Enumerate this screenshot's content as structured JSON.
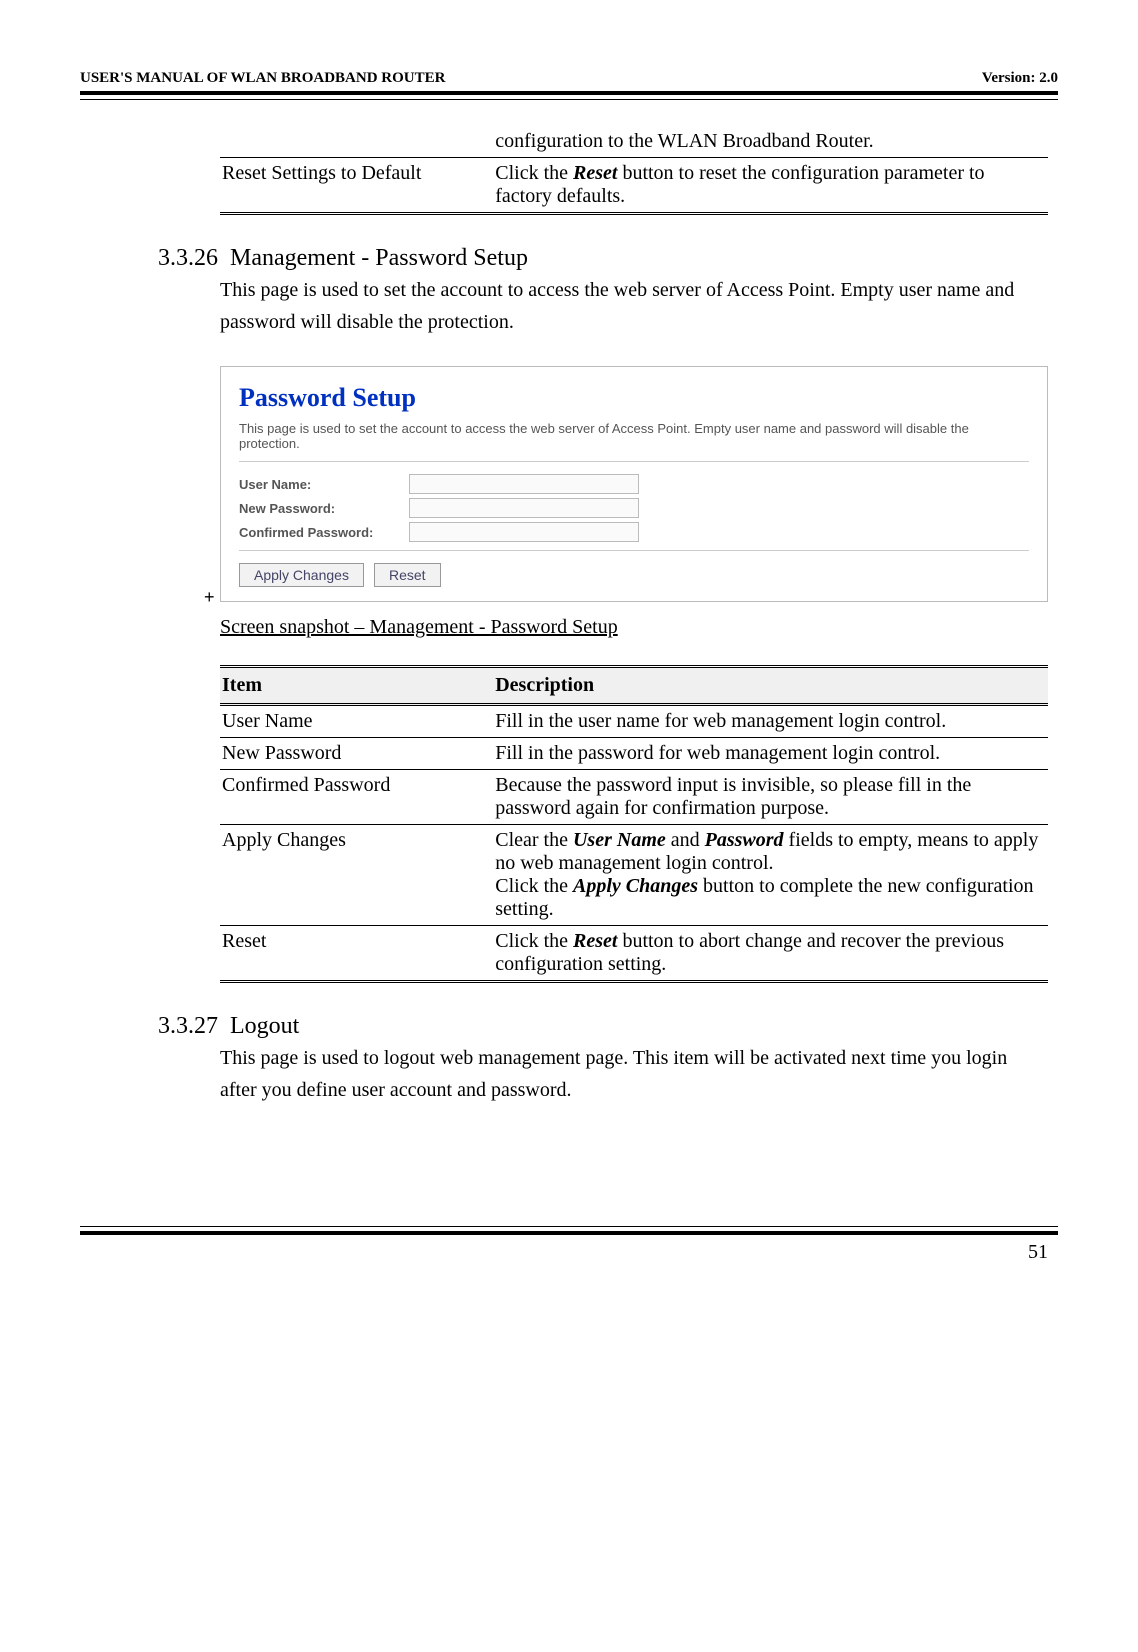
{
  "header": {
    "left": "USER'S MANUAL OF WLAN BROADBAND ROUTER",
    "right": "Version: 2.0"
  },
  "topTable": {
    "row0": {
      "item": "",
      "desc": "configuration to the WLAN Broadband Router."
    },
    "row1": {
      "item": "Reset Settings to Default",
      "desc_pre": "Click the ",
      "desc_bold": "Reset",
      "desc_post": " button to reset the configuration parameter to factory defaults."
    }
  },
  "section26": {
    "num": "3.3.26",
    "title": "Management - Password Setup",
    "body": "This page is used to set the account to access the web server of Access Point. Empty user name and password will disable the protection."
  },
  "passwordSetup": {
    "title": "Password Setup",
    "desc": "This page is used to set the account to access the web server of Access Point. Empty user name and password will disable the protection.",
    "labels": {
      "user": "User Name:",
      "newpw": "New Password:",
      "confpw": "Confirmed Password:"
    },
    "buttons": {
      "apply": "Apply Changes",
      "reset": "Reset"
    }
  },
  "caption26": "Screen snapshot – Management - Password Setup",
  "table26": {
    "head_item": "Item",
    "head_desc": "Description",
    "rows": {
      "r1_item": "User Name",
      "r1_desc": "Fill in the user name for web management login control.",
      "r2_item": "New Password",
      "r2_desc": "Fill in the password for web management login control.",
      "r3_item": "Confirmed Password",
      "r3_desc": "Because the password input is invisible, so please fill in the password again for confirmation purpose.",
      "r4_item": "Apply Changes",
      "r4_p1_a": "Clear the ",
      "r4_p1_bi1": "User Name",
      "r4_p1_b": " and ",
      "r4_p1_bi2": "Password",
      "r4_p1_c": " fields to empty, means to apply no web management login control.",
      "r4_p2_a": "Click the ",
      "r4_p2_bi": "Apply Changes",
      "r4_p2_b": " button to complete the new configuration setting.",
      "r5_item": "Reset",
      "r5_a": "Click the ",
      "r5_bi": "Reset",
      "r5_b": " button to abort change and recover the previous configuration setting."
    }
  },
  "section27": {
    "num": "3.3.27",
    "title": "Logout",
    "body": "This page is used to logout web management page. This item will be activated next time you login after you define user account and password."
  },
  "page_number": "51"
}
